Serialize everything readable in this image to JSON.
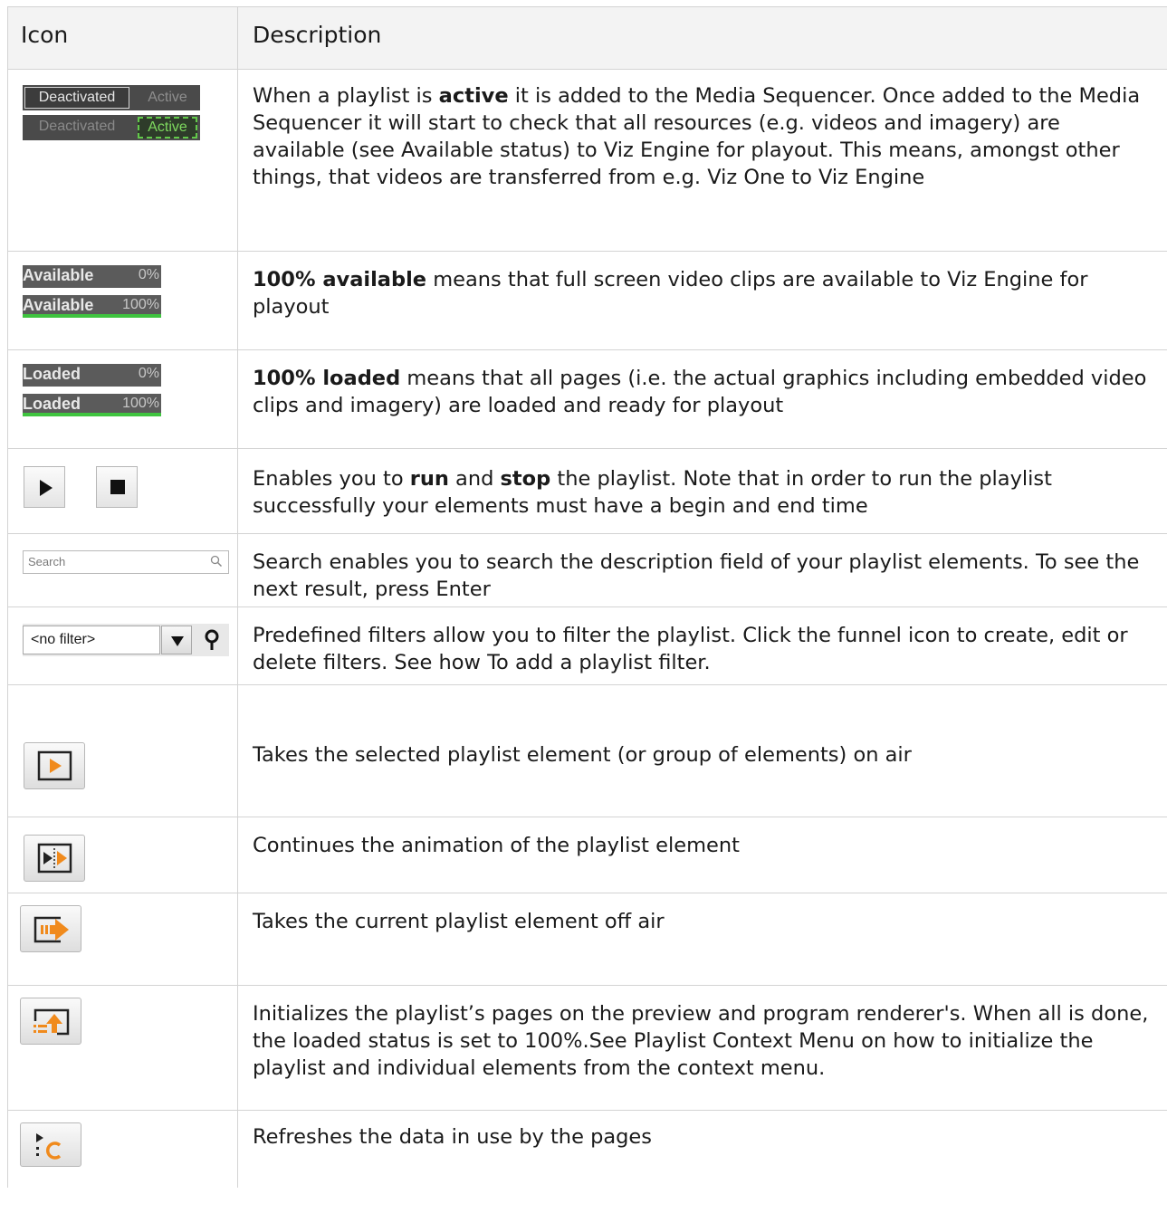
{
  "header": {
    "icon_col": "Icon",
    "description_col": "Description"
  },
  "widgets": {
    "deactivated_label": "Deactivated",
    "active_label": "Active",
    "available_label": "Available",
    "loaded_label": "Loaded",
    "pct_0": "0%",
    "pct_100": "100%",
    "search_placeholder": "Search",
    "filter_value": "<no filter>"
  },
  "rows": {
    "active": {
      "t1": "When a playlist is ",
      "b1": "active",
      "t2": " it is added to the Media Sequencer. Once added to the Media Sequencer it will start to check that all resources (e.g. videos and imagery) are available (see Available status) to Viz Engine for playout. This means, amongst other things, that videos are transferred from e.g. Viz One to Viz Engine"
    },
    "available": {
      "b1": "100% available",
      "t1": " means that full screen video clips are available to Viz Engine for playout"
    },
    "loaded": {
      "b1": "100% loaded",
      "t1": " means that all pages (i.e. the actual graphics including embedded video clips and imagery) are loaded and ready for playout"
    },
    "runstop": {
      "t1": " Enables you to ",
      "b1": "run",
      "t2": " and ",
      "b2": "stop",
      "t3": " the playlist. Note that in order to run the playlist successfully your elements must have a begin and end time"
    },
    "search": {
      "t1": "Search enables you to search the description field of your playlist elements. To see the next result, press Enter"
    },
    "filter": {
      "t1": "Predefined filters allow you to filter the playlist. Click the funnel icon to create, edit or delete filters. See how To add a playlist filter."
    },
    "take": {
      "t1": "Takes the selected playlist element (or group of elements) on air"
    },
    "continue": {
      "t1": "Continues the animation of the playlist element"
    },
    "takeout": {
      "t1": "Takes the current playlist element off air"
    },
    "initialize": {
      "t1": "Initializes the playlist’s pages on the preview and program renderer's. When all is done, the loaded status is set to 100%.See Playlist Context Menu on how to initialize the playlist and individual elements from the context menu."
    },
    "refresh": {
      "t1": " Refreshes the data in use by the pages"
    }
  },
  "progress": {
    "available_first": 0,
    "available_second": 100,
    "loaded_first": 0,
    "loaded_second": 100
  },
  "colors": {
    "active_green": "#62c94a",
    "progress_green": "#3fc43f",
    "orange": "#f08a1c",
    "header_bg": "#f3f3f3"
  }
}
